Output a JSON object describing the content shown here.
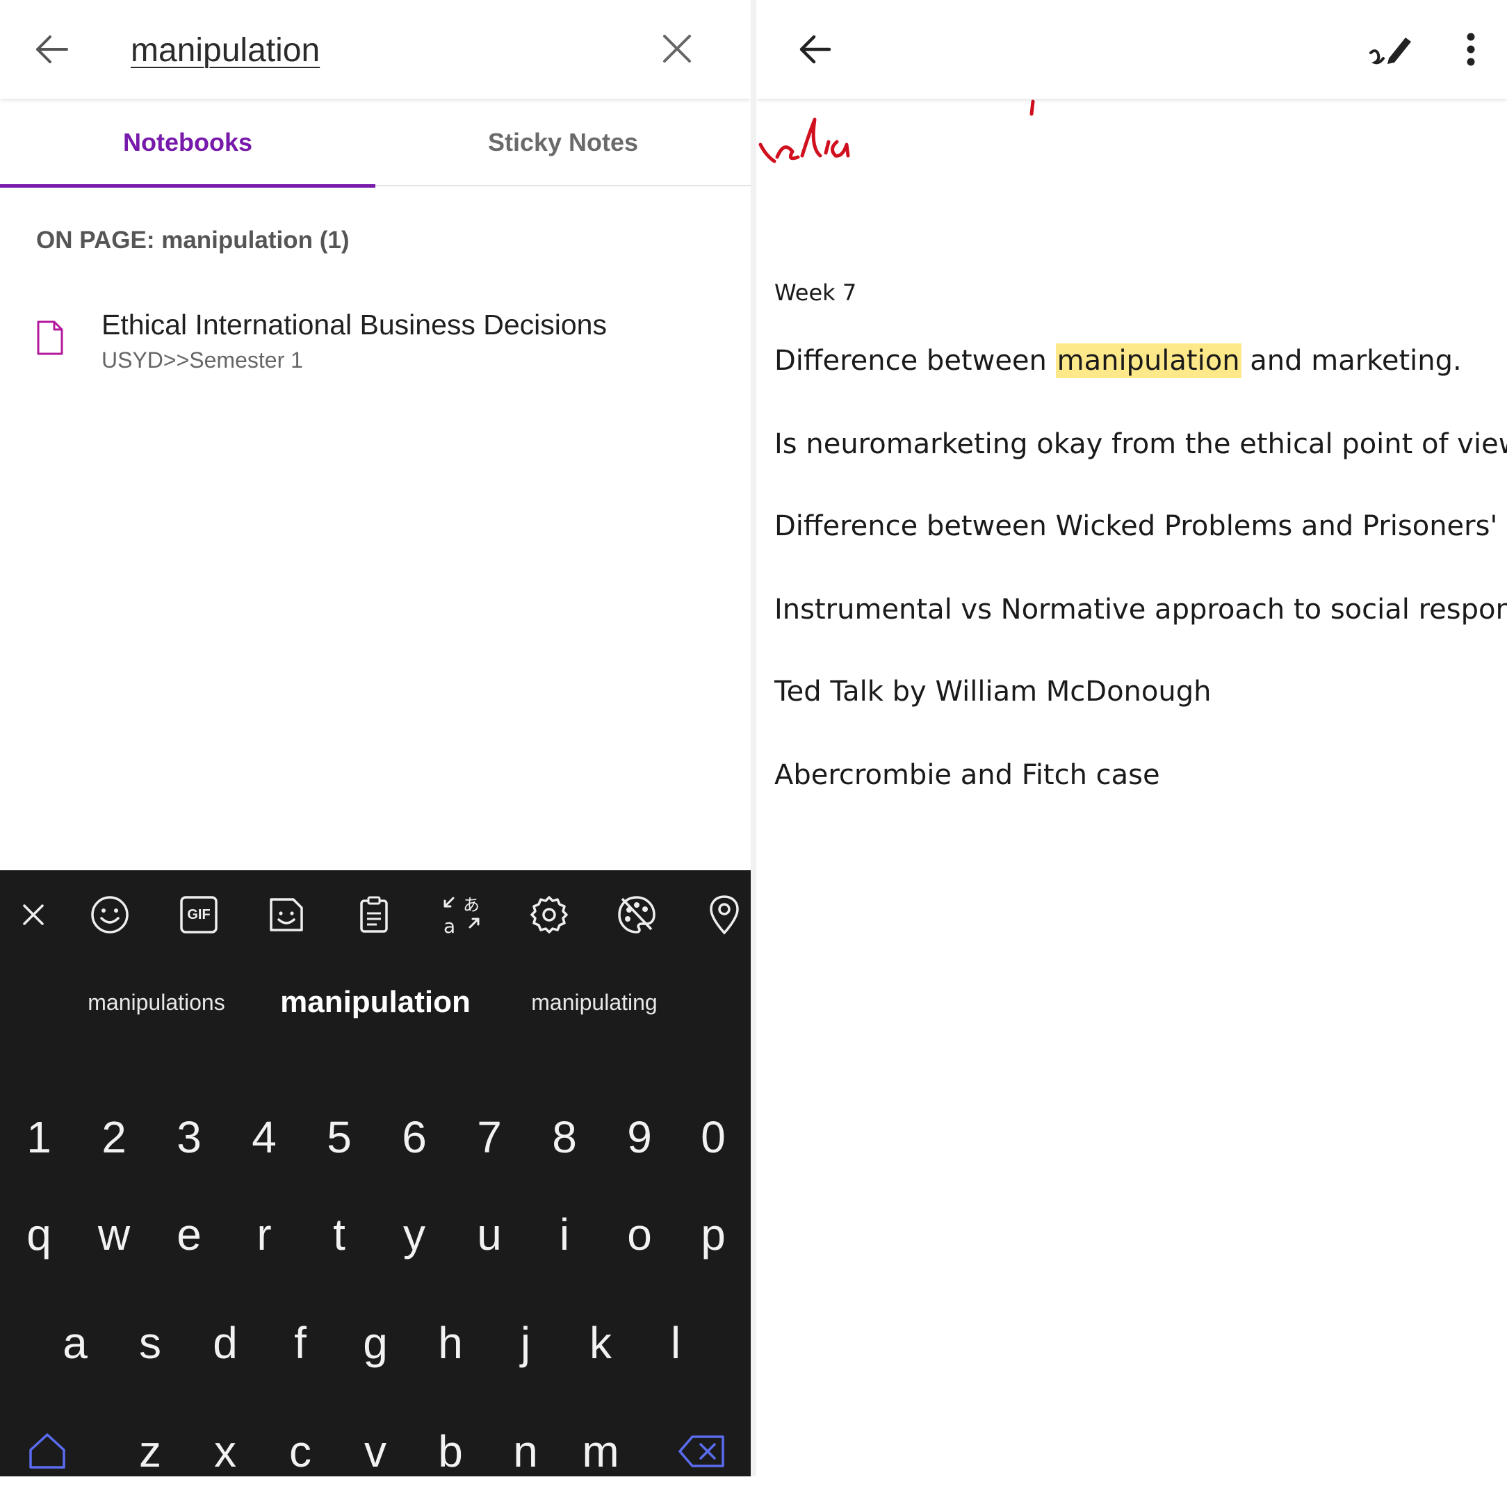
{
  "search": {
    "query": "manipulation",
    "tabs": [
      {
        "label": "Notebooks",
        "active": true
      },
      {
        "label": "Sticky Notes",
        "active": false
      }
    ],
    "section_header": "ON PAGE: manipulation (1)",
    "results": [
      {
        "title": "Ethical International Business Decisions",
        "path": "USYD>>Semester 1",
        "icon": "page-icon"
      }
    ]
  },
  "keyboard": {
    "toolbar_icons": [
      "close-icon",
      "emoji-icon",
      "gif-icon",
      "sticker-icon",
      "clipboard-icon",
      "translate-icon",
      "settings-icon",
      "theme-icon",
      "location-icon"
    ],
    "gif_label": "GIF",
    "suggestions": [
      "manipulations",
      "manipulation",
      "manipulating"
    ],
    "rows": [
      [
        "1",
        "2",
        "3",
        "4",
        "5",
        "6",
        "7",
        "8",
        "9",
        "0"
      ],
      [
        "q",
        "w",
        "e",
        "r",
        "t",
        "y",
        "u",
        "i",
        "o",
        "p"
      ],
      [
        "a",
        "s",
        "d",
        "f",
        "g",
        "h",
        "j",
        "k",
        "l"
      ],
      [
        "z",
        "x",
        "c",
        "v",
        "b",
        "n",
        "m"
      ]
    ]
  },
  "page": {
    "week": "Week 7",
    "line1": {
      "before": "Difference between ",
      "highlight": "manipulation",
      "after": " and marketing."
    },
    "lines": [
      "Is neuromarketing okay from the ethical point of view",
      "Difference between Wicked Problems and Prisoners' Dilemma",
      "Instrumental vs Normative approach to social responsibility",
      "Ted Talk by William McDonough",
      "Abercrombie and Fitch case"
    ]
  },
  "colors": {
    "accent": "#7719aa",
    "highlight": "#fde98a",
    "ink": "#d0101e",
    "keyboard_bg": "#1b1b1b",
    "shift": "#5a6cf0"
  }
}
